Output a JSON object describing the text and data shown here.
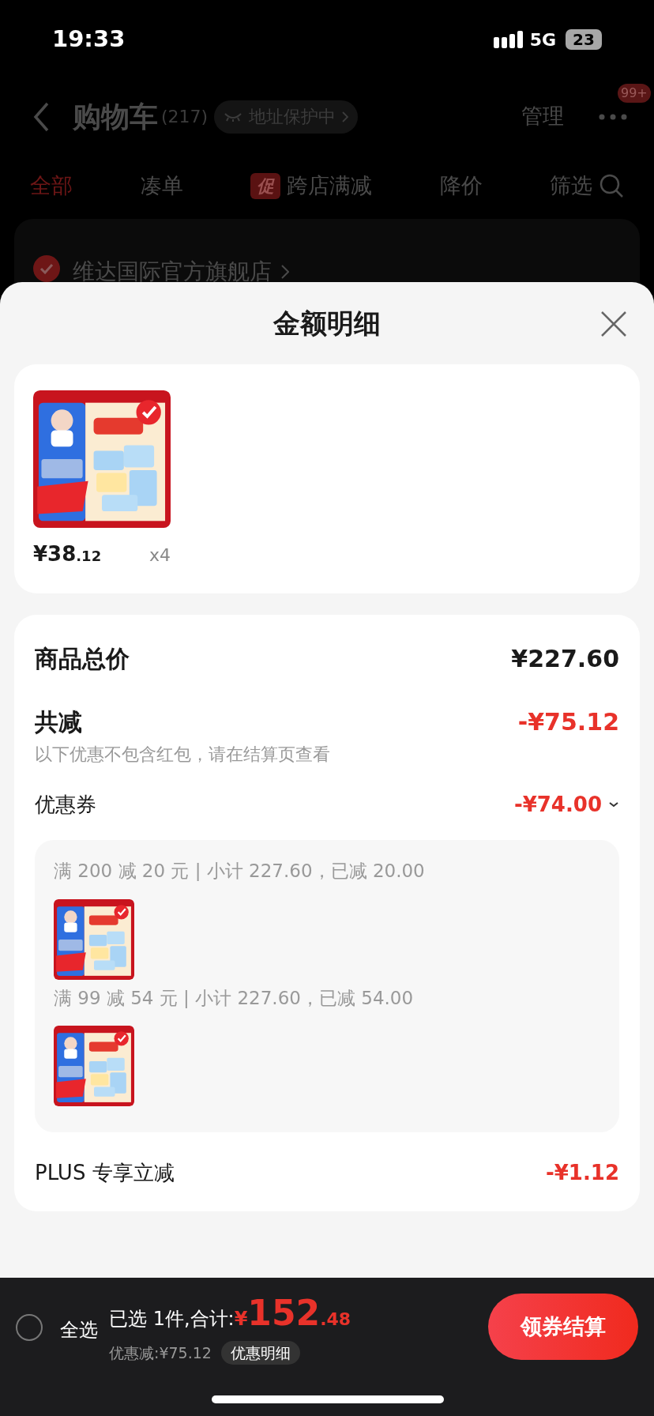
{
  "status_bar": {
    "time": "19:33",
    "network": "5G",
    "battery": "23"
  },
  "header": {
    "title": "购物车",
    "count": "(217)",
    "address_badge": "地址保护中",
    "manage": "管理",
    "more_badge": "99+"
  },
  "tabs": [
    {
      "label": "全部",
      "selected": true
    },
    {
      "label": "凑单",
      "selected": false
    },
    {
      "label": "跨店满减",
      "selected": false,
      "tag": "促"
    },
    {
      "label": "降价",
      "selected": false
    },
    {
      "label": "筛选",
      "selected": false
    }
  ],
  "store": {
    "name": "维达国际官方旗舰店",
    "checked": true
  },
  "sheet": {
    "title": "金额明细",
    "products": [
      {
        "price_main": "¥38",
        "price_decimal": ".12",
        "quantity": "x4"
      }
    ],
    "summary": {
      "total_label": "商品总价",
      "total_value": "¥227.60",
      "discount_label": "共减",
      "discount_value": "-¥75.12",
      "discount_note": "以下优惠不包含红包，请在结算页查看",
      "coupon_label": "优惠券",
      "coupon_value": "-¥74.00",
      "coupon_expanded": true,
      "coupons": [
        {
          "text": "满 200 减 20 元 | 小计 227.60，已减 20.00"
        },
        {
          "text": "满 99 减 54 元 | 小计 227.60，已减 54.00"
        }
      ],
      "plus_label": "PLUS 专享立减",
      "plus_value": "-¥1.12"
    }
  },
  "bottom_bar": {
    "select_all": "全选",
    "select_all_checked": false,
    "selected_text": "已选 1件,合计:",
    "currency": "¥",
    "total_main": "152",
    "total_decimal": ".48",
    "saved": "优惠减:¥75.12",
    "detail_button": "优惠明细",
    "checkout_button": "领券结算"
  }
}
